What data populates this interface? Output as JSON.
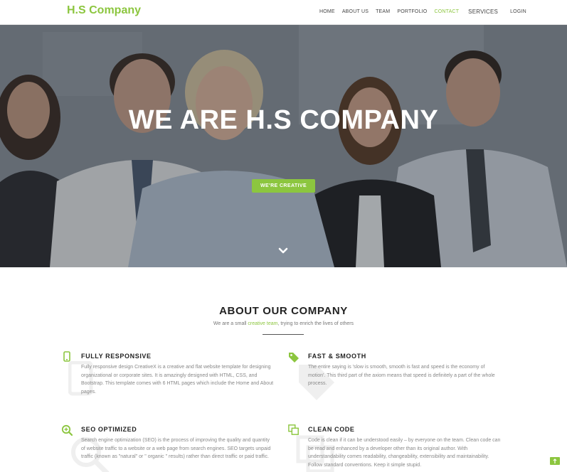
{
  "brand": "H.S Company",
  "nav": {
    "home": "HOME",
    "about": "ABOUT US",
    "team": "TEAM",
    "portfolio": "PORTFOLIO",
    "contact": "CONTACT",
    "services": "SERVICES",
    "login": "LOGIN",
    "active": "contact"
  },
  "hero": {
    "title": "WE ARE H.S COMPANY",
    "button": "WE'RE CREATIVE",
    "scroll_icon": "chevron-down-icon"
  },
  "about": {
    "title": "ABOUT OUR COMPANY",
    "subtitle_before": "We are a small ",
    "subtitle_highlight": "creative team",
    "subtitle_after": ", trying to enrich the lives of others"
  },
  "features": [
    {
      "icon": "mobile-icon",
      "title": "FULLY RESPONSIVE",
      "body": "Fully responsive design CreativeX is a creative and flat website template for designing organizational or corporate sites. It is amazingly designed with HTML, CSS, and Bootstrap. This template comes with 6 HTML pages which include the Home and About pages."
    },
    {
      "icon": "tag-icon",
      "title": "FAST & SMOOTH",
      "body": "The entire saying is 'slow is smooth, smooth is fast and speed is the economy of motion'. This third part of the axiom means that speed is definitely a part of the whole process."
    },
    {
      "icon": "search-plus-icon",
      "title": "SEO OPTIMIZED",
      "body": "Search engine optimization (SEO) is the process of improving the quality and quantity of website traffic to a website or a web page from search engines. SEO targets unpaid traffic (known as \"natural\" or \" organic \" results) rather than direct traffic or paid traffic."
    },
    {
      "icon": "copy-icon",
      "title": "CLEAN CODE",
      "body": "Code is clean if it can be understood easily – by everyone on the team. Clean code can be read and enhanced by a developer other than its original author. With understandability comes readability, changeability, extensibility and maintainability. Follow standard conventions. Keep it simple stupid."
    }
  ],
  "scroll_top_icon": "arrow-up-icon",
  "colors": {
    "accent": "#8cc63f",
    "heading": "#222222",
    "body_text": "#888888"
  }
}
